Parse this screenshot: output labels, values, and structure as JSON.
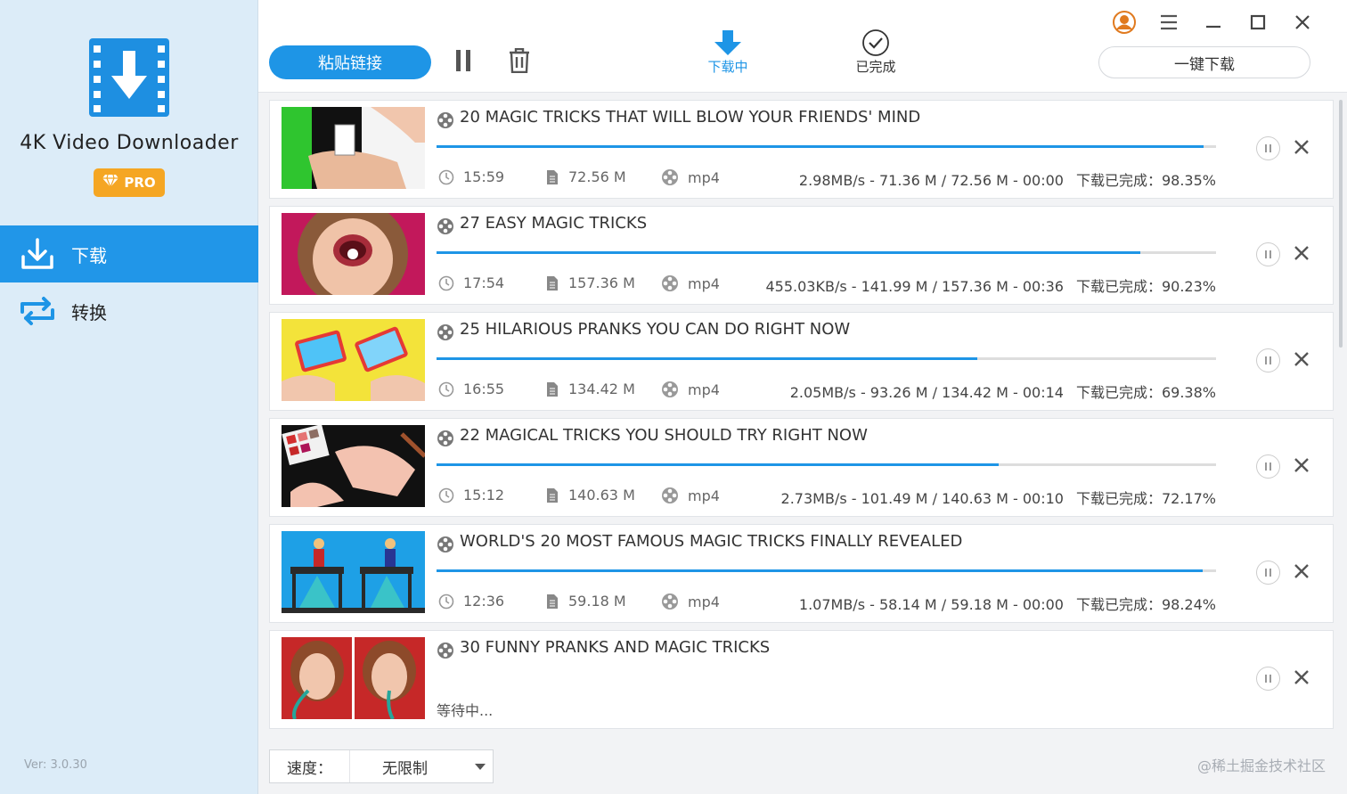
{
  "sidebar": {
    "app_title": "4K Video Downloader",
    "pro_label": "PRO",
    "nav": [
      {
        "label": "下载",
        "icon": "download-icon",
        "active": true
      },
      {
        "label": "转换",
        "icon": "convert-icon",
        "active": false
      }
    ],
    "version": "Ver: 3.0.30"
  },
  "toolbar": {
    "paste_label": "粘贴链接",
    "tab_downloading": "下载中",
    "tab_completed": "已完成",
    "onekey_label": "一键下载"
  },
  "colors": {
    "accent": "#1e95e6",
    "sidebar_bg": "#dcecf8",
    "pro_badge": "#f5a623"
  },
  "downloads": [
    {
      "title": "20 MAGIC TRICKS THAT WILL BLOW YOUR FRIENDS' MIND",
      "duration": "15:59",
      "size": "72.56 M",
      "format": "mp4",
      "stats": "2.98MB/s - 71.36 M / 72.56 M - 00:00",
      "percent_label": "下载已完成：98.35%",
      "progress": 0.9835,
      "status": "downloading"
    },
    {
      "title": "27 EASY MAGIC TRICKS",
      "duration": "17:54",
      "size": "157.36 M",
      "format": "mp4",
      "stats": "455.03KB/s - 141.99 M / 157.36 M - 00:36",
      "percent_label": "下载已完成：90.23%",
      "progress": 0.9023,
      "status": "downloading"
    },
    {
      "title": "25 HILARIOUS PRANKS YOU CAN DO RIGHT NOW",
      "duration": "16:55",
      "size": "134.42 M",
      "format": "mp4",
      "stats": "2.05MB/s - 93.26 M / 134.42 M - 00:14",
      "percent_label": "下载已完成：69.38%",
      "progress": 0.6938,
      "status": "downloading"
    },
    {
      "title": "22 MAGICAL TRICKS YOU SHOULD TRY RIGHT NOW",
      "duration": "15:12",
      "size": "140.63 M",
      "format": "mp4",
      "stats": "2.73MB/s - 101.49 M / 140.63 M - 00:10",
      "percent_label": "下载已完成：72.17%",
      "progress": 0.7217,
      "status": "downloading"
    },
    {
      "title": "WORLD'S 20 MOST FAMOUS MAGIC TRICKS FINALLY REVEALED",
      "duration": "12:36",
      "size": "59.18 M",
      "format": "mp4",
      "stats": "1.07MB/s - 58.14 M / 59.18 M - 00:00",
      "percent_label": "下载已完成：98.24%",
      "progress": 0.9824,
      "status": "downloading"
    },
    {
      "title": "30 FUNNY PRANKS AND MAGIC TRICKS",
      "waiting_label": "等待中...",
      "status": "waiting"
    }
  ],
  "footer": {
    "speed_label": "速度：",
    "speed_value": "无限制",
    "watermark": "@稀土掘金技术社区"
  }
}
